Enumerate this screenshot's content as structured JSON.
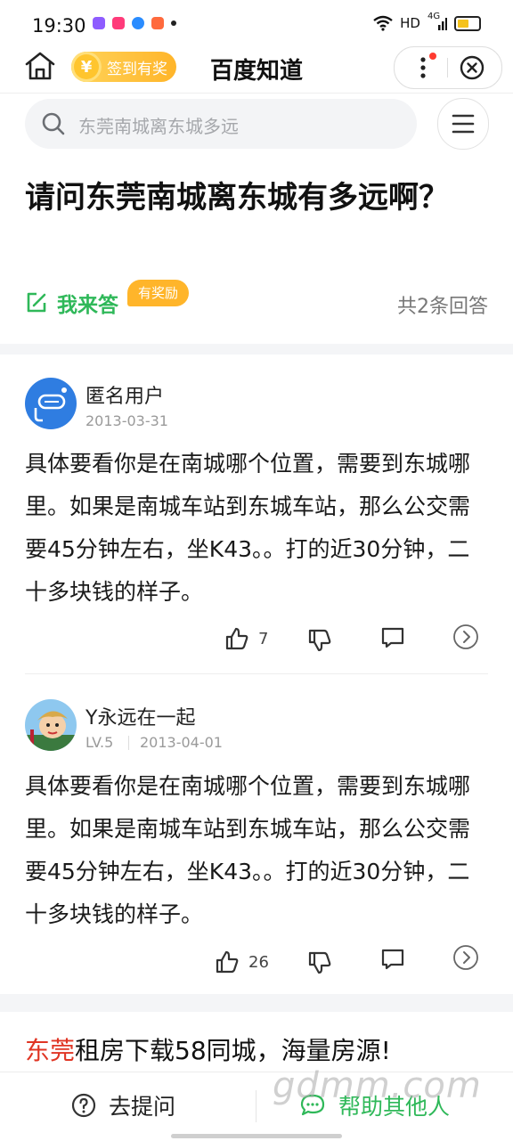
{
  "status_bar": {
    "time": "19:30",
    "network_label": "HD",
    "signal_label": "4G"
  },
  "header": {
    "checkin_label": "签到有奖",
    "coin_symbol": "¥",
    "title": "百度知道"
  },
  "search": {
    "placeholder": "东莞南城离东城多远"
  },
  "question": {
    "title": "请问东莞南城离东城有多远啊？",
    "answer_button_label": "我来答",
    "reward_badge": "有奖励",
    "answer_count": "共2条回答"
  },
  "answers": [
    {
      "username": "匿名用户",
      "level": "",
      "date": "2013-03-31",
      "content": "具体要看你是在南城哪个位置，需要到东城哪里。如果是南城车站到东城车站，那么公交需要45分钟左右，坐K43。。打的近30分钟，二十多块钱的样子。",
      "likes": "7"
    },
    {
      "username": "Y永远在一起",
      "level": "LV.5",
      "date": "2013-04-01",
      "content": "具体要看你是在南城哪个位置，需要到东城哪里。如果是南城车站到东城车站，那么公交需要45分钟左右，坐K43。。打的近30分钟，二十多块钱的样子。",
      "likes": "26"
    }
  ],
  "ad": {
    "highlight": "东莞",
    "text": "租房下载58同城，海量房源!"
  },
  "bottom_bar": {
    "ask_label": "去提问",
    "help_label": "帮助其他人"
  },
  "watermark": "gdmm.com",
  "colors": {
    "brand_green": "#2fb859",
    "reward_orange": "#ffb52a",
    "ad_red": "#e03524"
  }
}
